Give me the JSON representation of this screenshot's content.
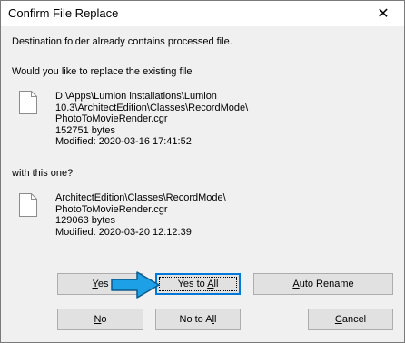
{
  "window": {
    "title": "Confirm File Replace",
    "close_glyph": "✕"
  },
  "messages": {
    "line1": "Destination folder already contains processed file.",
    "line2": "Would you like to replace the existing file",
    "line3": "with this one?"
  },
  "existing_file": {
    "icon": "file-icon",
    "path_line1": "D:\\Apps\\Lumion installations\\Lumion",
    "path_line2": "10.3\\ArchitectEdition\\Classes\\RecordMode\\",
    "path_line3": "PhotoToMovieRender.cgr",
    "size": "152751 bytes",
    "modified": "Modified: 2020-03-16 17:41:52"
  },
  "new_file": {
    "icon": "file-icon",
    "path_line1": "ArchitectEdition\\Classes\\RecordMode\\",
    "path_line2": "PhotoToMovieRender.cgr",
    "size": "129063 bytes",
    "modified": "Modified: 2020-03-20 12:12:39"
  },
  "buttons": {
    "yes": {
      "mnemonic": "Y",
      "rest": "es"
    },
    "yes_to_all": {
      "before": "Yes to ",
      "mnemonic": "A",
      "rest": "ll"
    },
    "auto_rename": {
      "mnemonic": "A",
      "rest": "uto Rename"
    },
    "no": {
      "mnemonic": "N",
      "rest": "o"
    },
    "no_to_all": {
      "before": "No to A",
      "mnemonic": "l",
      "rest": "l"
    },
    "cancel": {
      "mnemonic": "C",
      "rest": "ancel"
    }
  },
  "colors": {
    "dialog_bg": "#f0f0f0",
    "button_bg": "#e1e1e1",
    "accent": "#0078d7",
    "arrow_fill": "#1ea0e6"
  }
}
